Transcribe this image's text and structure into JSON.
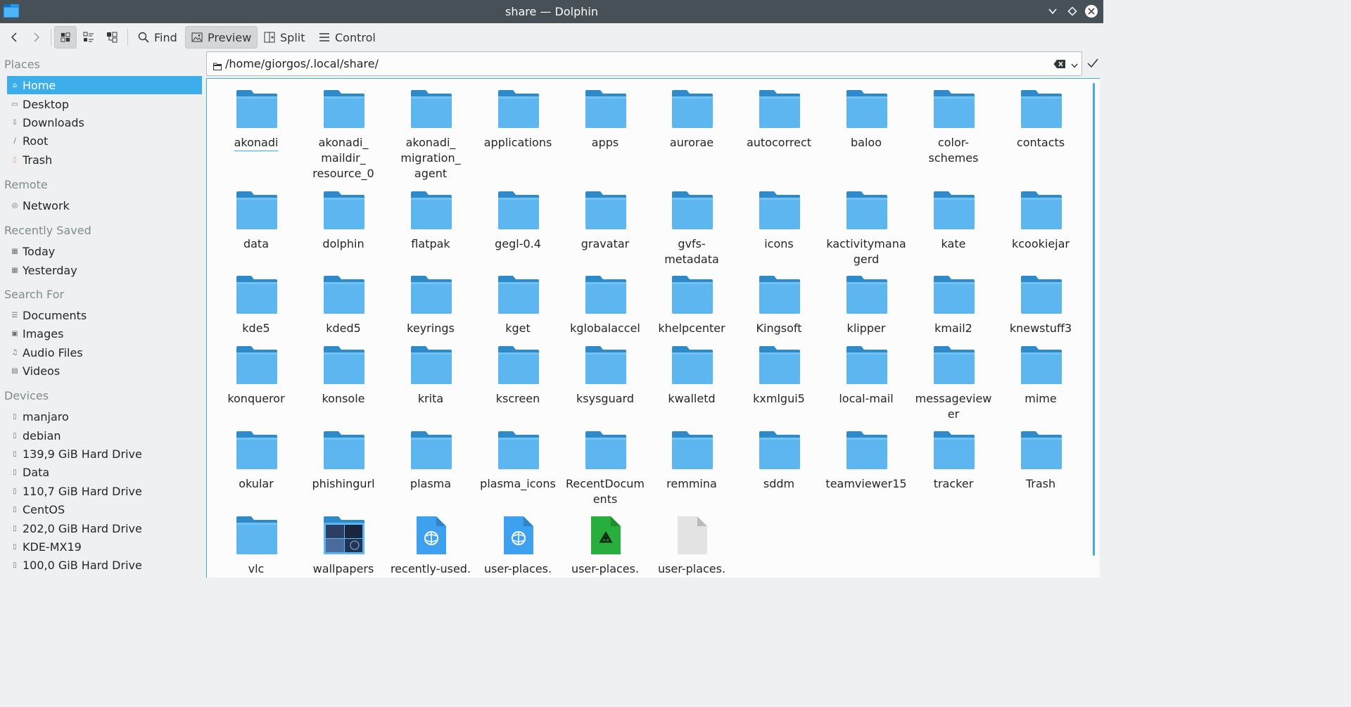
{
  "window": {
    "title": "share — Dolphin",
    "buttons": [
      "chevron-down-icon",
      "diamond-icon",
      "close-icon"
    ]
  },
  "toolbar": {
    "find_label": "Find",
    "preview_label": "Preview",
    "split_label": "Split",
    "control_label": "Control"
  },
  "sidebar": {
    "places_heading": "Places",
    "places": [
      "Home",
      "Desktop",
      "Downloads",
      "Root",
      "Trash"
    ],
    "remote_heading": "Remote",
    "remote": [
      "Network"
    ],
    "recent_heading": "Recently Saved",
    "recent": [
      "Today",
      "Yesterday"
    ],
    "search_heading": "Search For",
    "search": [
      "Documents",
      "Images",
      "Audio Files",
      "Videos"
    ],
    "devices_heading": "Devices",
    "devices": [
      "manjaro",
      "debian",
      "139,9 GiB Hard Drive",
      "Data",
      "110,7 GiB Hard Drive",
      "CentOS",
      "202,0 GiB Hard Drive",
      "KDE-MX19",
      "100,0 GiB Hard Drive"
    ]
  },
  "location": {
    "path": "/home/giorgos/.local/share/"
  },
  "files": [
    [
      "akonadi",
      "akonadi_\nmaildir_\nresource_0",
      "akonadi_\nmigration_\nagent",
      "applications",
      "apps",
      "aurorae",
      "autocorrect",
      "baloo",
      "color-\nschemes",
      "contacts"
    ],
    [
      "data",
      "dolphin",
      "flatpak",
      "gegl-0.4",
      "gravatar",
      "gvfs-\nmetadata",
      "icons",
      "kactivitymana\ngerd",
      "kate",
      "kcookiejar"
    ],
    [
      "kde5",
      "kded5",
      "keyrings",
      "kget",
      "kglobalaccel",
      "khelpcenter",
      "Kingsoft",
      "klipper",
      "kmail2",
      "knewstuff3"
    ],
    [
      "konqueror",
      "konsole",
      "krita",
      "kscreen",
      "ksysguard",
      "kwalletd",
      "kxmlgui5",
      "local-mail",
      "messageview\ner",
      "mime"
    ],
    [
      "okular",
      "phishingurl",
      "plasma",
      "plasma_icons",
      "RecentDocum\nents",
      "remmina",
      "sddm",
      "teamviewer15",
      "tracker",
      "Trash"
    ],
    [
      "vlc",
      "wallpapers",
      "recently-used.",
      "user-places.",
      "user-places.",
      "user-places."
    ]
  ],
  "last_row_icons": [
    "folder",
    "image-folder",
    "xml-file",
    "xml-file",
    "recycle-file",
    "blank-file"
  ],
  "colors": {
    "accent": "#3daee9",
    "folder": "#5eb6f0",
    "folder_tab": "#2e8ac8",
    "titlebar": "#475057"
  }
}
